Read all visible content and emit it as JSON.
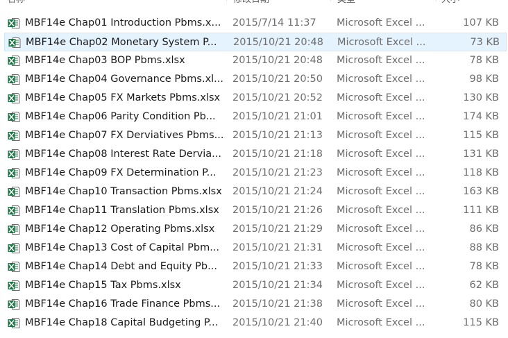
{
  "columns": {
    "name": "名称",
    "date": "修改日期",
    "type": "类型",
    "size": "大小"
  },
  "colors": {
    "selected_bg": "#e5f3ff",
    "selected_border": "#cce8ff",
    "excel_green": "#1d7244"
  },
  "icon": "excel-file-icon",
  "files": [
    {
      "name": "MBF14e Chap01 Introduction Pbms.x...",
      "date": "2015/7/14 11:37",
      "type": "Microsoft Excel ...",
      "size": "107 KB",
      "selected": false
    },
    {
      "name": "MBF14e Chap02 Monetary System P...",
      "date": "2015/10/21 20:48",
      "type": "Microsoft Excel ...",
      "size": "73 KB",
      "selected": true
    },
    {
      "name": "MBF14e Chap03 BOP Pbms.xlsx",
      "date": "2015/10/21 20:48",
      "type": "Microsoft Excel ...",
      "size": "78 KB",
      "selected": false
    },
    {
      "name": "MBF14e Chap04 Governance Pbms.xl...",
      "date": "2015/10/21 20:50",
      "type": "Microsoft Excel ...",
      "size": "98 KB",
      "selected": false
    },
    {
      "name": "MBF14e Chap05 FX Markets Pbms.xlsx",
      "date": "2015/10/21 20:52",
      "type": "Microsoft Excel ...",
      "size": "130 KB",
      "selected": false
    },
    {
      "name": "MBF14e Chap06 Parity Condition Pb...",
      "date": "2015/10/21 21:01",
      "type": "Microsoft Excel ...",
      "size": "174 KB",
      "selected": false
    },
    {
      "name": "MBF14e Chap07 FX Derviatives Pbms...",
      "date": "2015/10/21 21:13",
      "type": "Microsoft Excel ...",
      "size": "115 KB",
      "selected": false
    },
    {
      "name": "MBF14e Chap08 Interest Rate Dervia...",
      "date": "2015/10/21 21:18",
      "type": "Microsoft Excel ...",
      "size": "131 KB",
      "selected": false
    },
    {
      "name": "MBF14e Chap09 FX Determination P...",
      "date": "2015/10/21 21:23",
      "type": "Microsoft Excel ...",
      "size": "118 KB",
      "selected": false
    },
    {
      "name": "MBF14e Chap10 Transaction Pbms.xlsx",
      "date": "2015/10/21 21:24",
      "type": "Microsoft Excel ...",
      "size": "163 KB",
      "selected": false
    },
    {
      "name": "MBF14e Chap11 Translation Pbms.xlsx",
      "date": "2015/10/21 21:26",
      "type": "Microsoft Excel ...",
      "size": "111 KB",
      "selected": false
    },
    {
      "name": "MBF14e Chap12 Operating Pbms.xlsx",
      "date": "2015/10/21 21:29",
      "type": "Microsoft Excel ...",
      "size": "86 KB",
      "selected": false
    },
    {
      "name": "MBF14e Chap13 Cost of Capital Pbm...",
      "date": "2015/10/21 21:31",
      "type": "Microsoft Excel ...",
      "size": "88 KB",
      "selected": false
    },
    {
      "name": "MBF14e Chap14 Debt and Equity Pb...",
      "date": "2015/10/21 21:33",
      "type": "Microsoft Excel ...",
      "size": "78 KB",
      "selected": false
    },
    {
      "name": "MBF14e Chap15 Tax Pbms.xlsx",
      "date": "2015/10/21 21:34",
      "type": "Microsoft Excel ...",
      "size": "62 KB",
      "selected": false
    },
    {
      "name": "MBF14e Chap16 Trade Finance Pbms...",
      "date": "2015/10/21 21:38",
      "type": "Microsoft Excel ...",
      "size": "80 KB",
      "selected": false
    },
    {
      "name": "MBF14e Chap18 Capital Budgeting P...",
      "date": "2015/10/21 21:40",
      "type": "Microsoft Excel ...",
      "size": "115 KB",
      "selected": false
    }
  ]
}
